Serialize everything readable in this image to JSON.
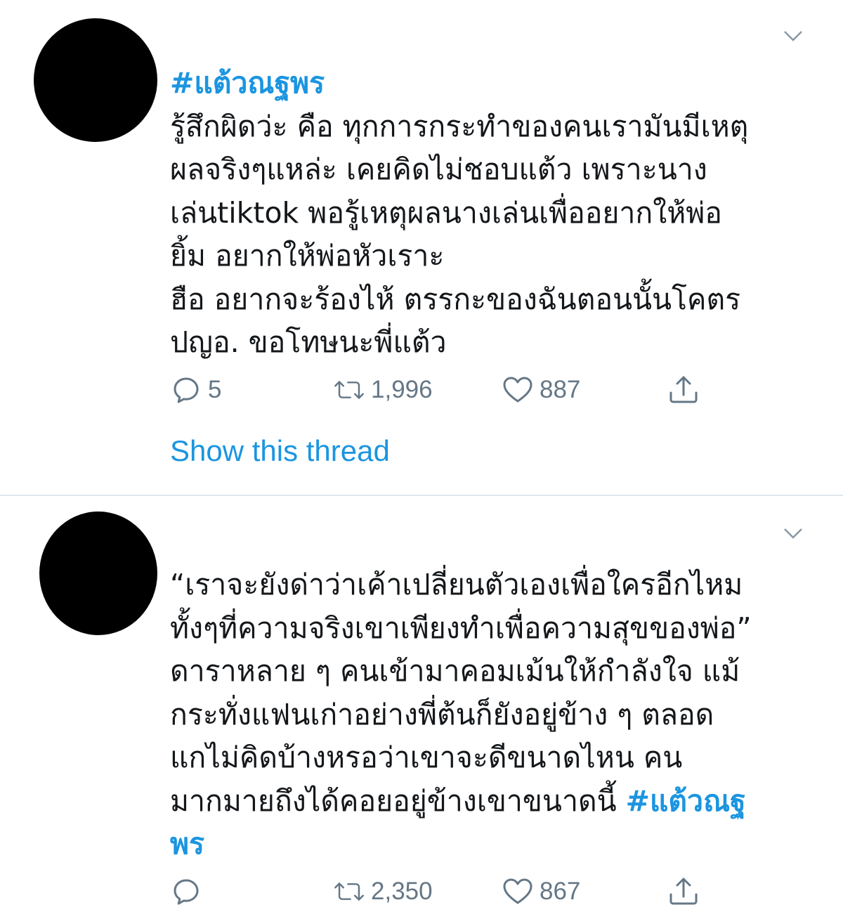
{
  "tweets": [
    {
      "hashtag_top": "#แต้วณฐพร",
      "body": "รู้สึกผิดว่ะ คือ ทุกการกระทำของคนเรามันมีเหตุ\nผลจริงๆแหล่ะ เคยคิดไม่ชอบแต้ว เพราะนาง\nเล่นtiktok พอรู้เหตุผลนางเล่นเพื่ออยากให้พ่อ\nยิ้ม อยากให้พ่อหัวเราะ\nฮือ อยากจะร้องไห้ ตรรกะของฉันตอนนั้นโคตร\nปญอ. ขอโทษนะพี่แต้ว",
      "replies": "5",
      "retweets": "1,996",
      "likes": "887",
      "show_thread": "Show this thread"
    },
    {
      "body": "“เราจะยังด่าว่าเค้าเปลี่ยนตัวเองเพื่อใครอีกไหม\nทั้งๆที่ความจริงเขาเพียงทำเพื่อความสุขของพ่อ”\nดาราหลาย ๆ คนเข้ามาคอมเม้นให้กำลังใจ แม้\nกระทั่งแฟนเก่าอย่างพี่ต้นก็ยังอยู่ข้าง ๆ ตลอด\nแกไม่คิดบ้างหรอว่าเขาจะดีขนาดไหน คน\nมากมายถึงได้คอยอยู่ข้างเขาขนาดนี้ ",
      "hashtag_end": "#แต้วณฐ\nพร",
      "replies": "",
      "retweets": "2,350",
      "likes": "867"
    }
  ],
  "colors": {
    "link": "#1b95e0",
    "text": "#14171a",
    "muted": "#657786",
    "divider": "#e1e8ed"
  },
  "icons": [
    "reply-icon",
    "retweet-icon",
    "like-icon",
    "share-icon",
    "chevron-down-icon"
  ]
}
